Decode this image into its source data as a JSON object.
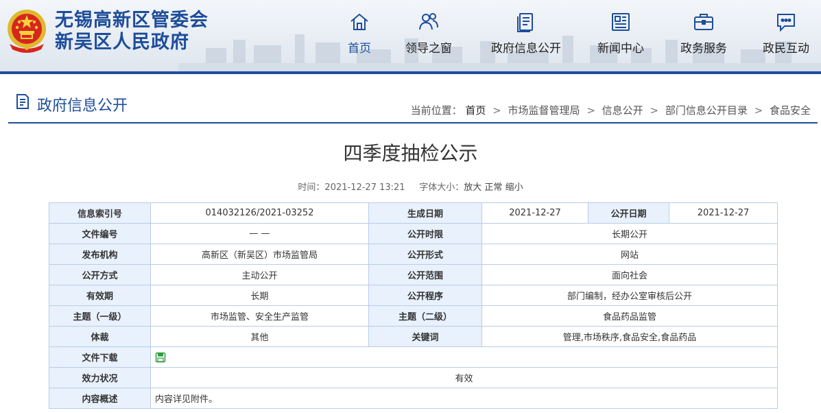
{
  "header": {
    "logo_line1": "无锡高新区管委会",
    "logo_line2": "新吴区人民政府",
    "brand_color": "#1d4d9a",
    "emblem_icon": "national-emblem-icon"
  },
  "nav": [
    {
      "label": "首页",
      "icon": "home-icon",
      "active": true
    },
    {
      "label": "领导之窗",
      "icon": "leaders-icon"
    },
    {
      "label": "政府信息公开",
      "icon": "document-list-icon"
    },
    {
      "label": "新闻中心",
      "icon": "newspaper-icon"
    },
    {
      "label": "政务服务",
      "icon": "briefcase-icon"
    },
    {
      "label": "政民互动",
      "icon": "chat-icon"
    }
  ],
  "section": {
    "title": "政府信息公开",
    "breadcrumb_prefix": "当前位置：",
    "breadcrumb": [
      "首页",
      "市场监督管理局",
      "信息公开",
      "部门信息公开目录",
      "食品安全"
    ],
    "separator": ">"
  },
  "article": {
    "title": "四季度抽检公示",
    "time_label": "时间：",
    "time": "2021-12-27 13:21",
    "font_size_label": "字体大小：",
    "font_size_options": [
      "放大",
      "正常",
      "缩小"
    ]
  },
  "info_table": {
    "index_label": "信息索引号",
    "index_value": "014032126/2021-03252",
    "created_label": "生成日期",
    "created_value": "2021-12-27",
    "published_label": "公开日期",
    "published_value": "2021-12-27",
    "doc_no_label": "文件编号",
    "doc_no_value": "— —",
    "term_label": "公开时限",
    "term_value": "长期公开",
    "issuer_label": "发布机构",
    "issuer_value": "高新区（新吴区）市场监管局",
    "form_label": "公开形式",
    "form_value": "网站",
    "method_label": "公开方式",
    "method_value": "主动公开",
    "scope_label": "公开范围",
    "scope_value": "面向社会",
    "validity_label": "有效期",
    "validity_value": "长期",
    "procedure_label": "公开程序",
    "procedure_value": "部门编制，经办公室审核后公开",
    "topic1_label": "主题（一级）",
    "topic1_value": "市场监管、安全生产监管",
    "topic2_label": "主题（二级）",
    "topic2_value": "食品药品监管",
    "genre_label": "体裁",
    "genre_value": "其他",
    "keywords_label": "关键词",
    "keywords_value": "管理,市场秩序,食品安全,食品药品",
    "download_label": "文件下载",
    "download_icon": "save-file-icon",
    "status_label": "效力状况",
    "status_value": "有效",
    "summary_label": "内容概述",
    "summary_value": "内容详见附件。"
  }
}
